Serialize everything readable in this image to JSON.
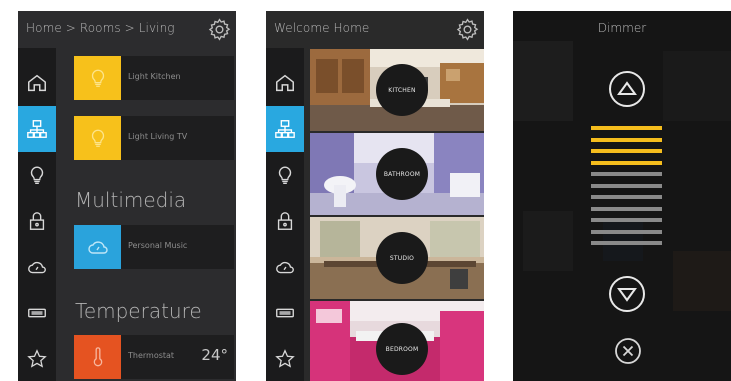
{
  "screen1": {
    "title": "Home > Rooms > Living",
    "nav": [
      {
        "icon": "home-icon",
        "active": false
      },
      {
        "icon": "network-icon",
        "active": true
      },
      {
        "icon": "bulb-icon",
        "active": false
      },
      {
        "icon": "lock-icon",
        "active": false
      },
      {
        "icon": "cloud-icon",
        "active": false
      },
      {
        "icon": "device-icon",
        "active": false
      },
      {
        "icon": "star-icon",
        "active": false
      }
    ],
    "lights": [
      {
        "label": "Light Kitchen",
        "color": "#f7c11b"
      },
      {
        "label": "Light Living TV",
        "color": "#f7c11b"
      }
    ],
    "multimedia_heading": "Multimedia",
    "multimedia_tile": {
      "label": "Personal Music",
      "color": "#2aa3dc"
    },
    "temperature_heading": "Temperature",
    "thermostat": {
      "label": "Thermostat",
      "value": "24°",
      "color": "#e55321"
    }
  },
  "screen2": {
    "title": "Welcome Home",
    "rooms": [
      "KITCHEN",
      "BATHROOM",
      "STUDIO",
      "BEDROOM"
    ]
  },
  "screen3": {
    "title": "Dimmer",
    "level_on": 4,
    "level_total": 11,
    "colors": {
      "on": "#f5bd1d",
      "off": "#8a8a8a"
    }
  }
}
